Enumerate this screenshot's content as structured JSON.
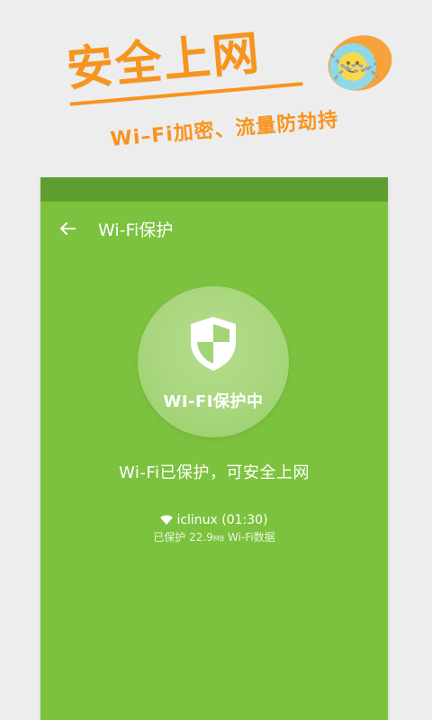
{
  "promo": {
    "title": "安全上网",
    "subtitle": "Wi–Fi加密、流量防劫持"
  },
  "appbar": {
    "title": "Wi-Fi保护"
  },
  "status_circle": {
    "label": "WI-FI保护中"
  },
  "main": {
    "protected_message": "Wi-Fi已保护，可安全上网"
  },
  "network": {
    "name_time": "iclinux (01:30)",
    "sub_prefix": "已保护 22.9",
    "sub_unit": "MB",
    "sub_suffix": " Wi-Fi数据"
  },
  "colors": {
    "accent": "#f7941d",
    "phone_bg": "#7cc23e",
    "status_bar": "#5f9e2e"
  },
  "icons": {
    "back": "back-arrow-icon",
    "shield": "shield-icon",
    "wifi": "wifi-icon",
    "mascot": "mascot-chained-lock-icon"
  }
}
